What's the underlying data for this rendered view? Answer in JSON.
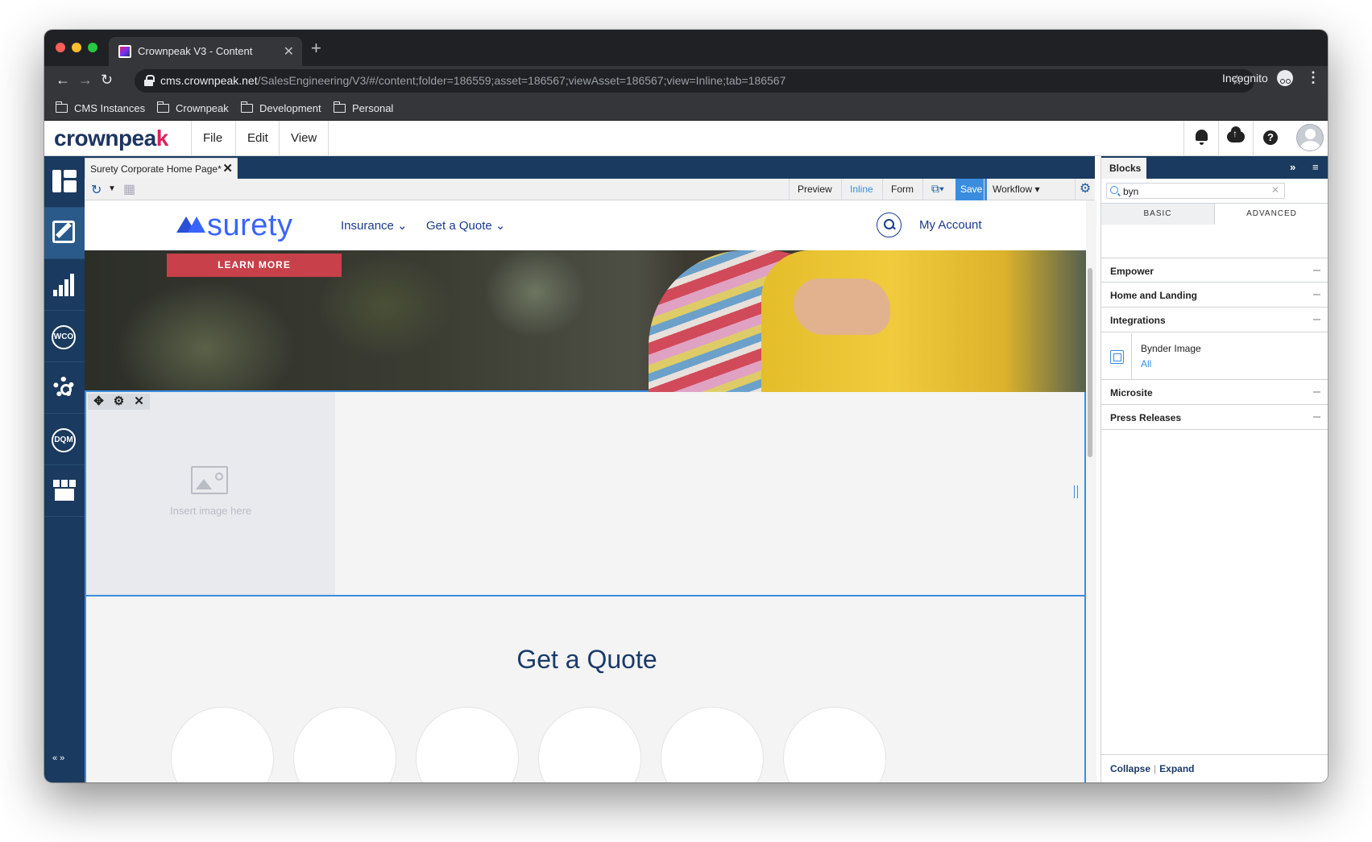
{
  "browser": {
    "tab_title": "Crownpeak V3 - Content",
    "url_host": "cms.crownpeak.net",
    "url_path": "/SalesEngineering/V3/#/content;folder=186559;asset=186567;viewAsset=186567;view=Inline;tab=186567",
    "incognito_label": "Incognito",
    "bookmarks": [
      "CMS Instances",
      "Crownpeak",
      "Development",
      "Personal"
    ]
  },
  "cms": {
    "logo_main": "crownpea",
    "logo_accent": "k",
    "menu": [
      "File",
      "Edit",
      "View"
    ],
    "sidebar_labels": {
      "wco": "WCO",
      "dqm": "DQM"
    },
    "doc_tab": "Surety Corporate Home Page*",
    "toolbar": {
      "preview": "Preview",
      "inline": "Inline",
      "form": "Form",
      "save": "Save",
      "workflow": "Workflow"
    }
  },
  "site": {
    "logo": "surety",
    "nav": [
      "Insurance",
      "Get a Quote"
    ],
    "my_account": "My Account",
    "learn_more": "LEARN MORE",
    "insert_image": "Insert image here",
    "quote_title": "Get a Quote"
  },
  "blocks_panel": {
    "title": "Blocks",
    "search_value": "byn",
    "tabs": [
      "BASIC",
      "ADVANCED"
    ],
    "categories": [
      "Empower",
      "Home and Landing",
      "Integrations",
      "Microsite",
      "Press Releases"
    ],
    "block_item": {
      "name": "Bynder Image",
      "tag": "All"
    },
    "footer_collapse": "Collapse",
    "footer_expand": "Expand"
  },
  "colors": {
    "cms_navy": "#1a3a5f",
    "accent_blue": "#3a8dde",
    "brand_pink": "#e01e5a",
    "surety_blue": "#3a64ff",
    "learn_red": "#c8404a"
  }
}
